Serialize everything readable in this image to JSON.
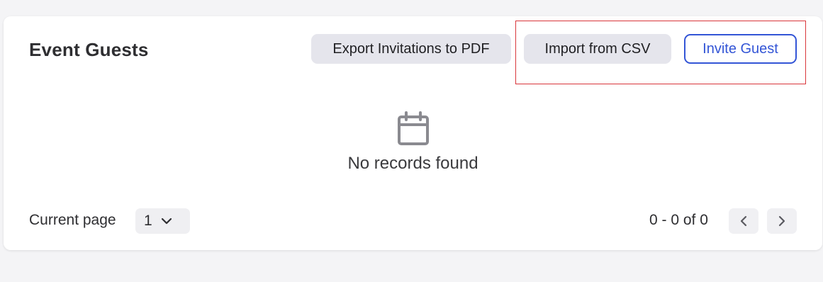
{
  "header": {
    "title": "Event Guests",
    "export_label": "Export Invitations to PDF",
    "import_label": "Import from CSV",
    "invite_label": "Invite Guest"
  },
  "empty_state": {
    "icon": "calendar-icon",
    "message": "No records found"
  },
  "pagination": {
    "current_page_label": "Current page",
    "current_page_value": "1",
    "range_text": "0 - 0 of 0",
    "prev_icon": "chevron-left-icon",
    "next_icon": "chevron-right-icon"
  },
  "colors": {
    "accent": "#3355d6",
    "highlight": "#d9363b",
    "secondary_button_bg": "#e5e5ec",
    "page_bg": "#f4f4f6"
  }
}
